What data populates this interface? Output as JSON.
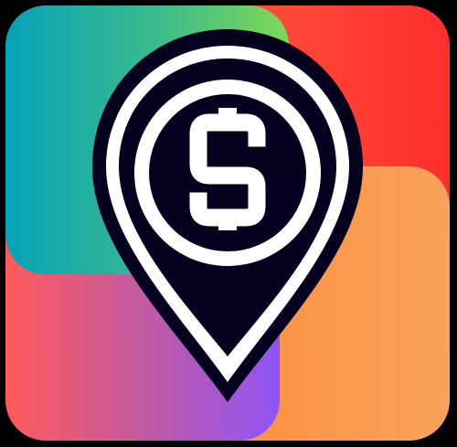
{
  "icon": {
    "name": "location-pin-dollar-icon",
    "glyph": "$",
    "colors": {
      "background": "#000000",
      "pin_fill": "#05001e",
      "pin_ring": "#ffffff",
      "tile_top_left": [
        "#05a3b8",
        "#3dbb8a",
        "#7ed957"
      ],
      "tile_top_right": [
        "#ff5a3c",
        "#ff2e2e"
      ],
      "tile_bottom_left": [
        "#ff5a5a",
        "#c25aa3",
        "#8f54f5"
      ],
      "tile_bottom_right": [
        "#ff8a3a",
        "#f7a35a"
      ]
    }
  }
}
